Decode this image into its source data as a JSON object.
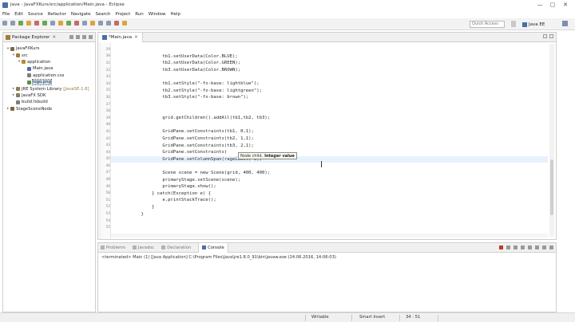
{
  "window": {
    "title": "Java - JavaFXKurs/src/application/Main.java - Eclipse",
    "controls": [
      "—",
      "▢",
      "✕"
    ]
  },
  "menu": [
    "File",
    "Edit",
    "Source",
    "Refactor",
    "Navigate",
    "Search",
    "Project",
    "Run",
    "Window",
    "Help"
  ],
  "toolbar": {
    "quick_access": "Quick Access",
    "perspective": "Java EE"
  },
  "explorer": {
    "tab": "Package Explorer",
    "tree": [
      {
        "label": "JavaFXKurs",
        "muted": "",
        "depth": 0,
        "twisty": "▾",
        "color": "#7a6a3a"
      },
      {
        "label": "src",
        "muted": "",
        "depth": 1,
        "twisty": "▾",
        "color": "#a07b3b"
      },
      {
        "label": "application",
        "muted": "",
        "depth": 2,
        "twisty": "▾",
        "color": "#b08a3e"
      },
      {
        "label": "Main.java",
        "muted": "",
        "depth": 3,
        "twisty": "",
        "color": "#4a6fa5"
      },
      {
        "label": "application.css",
        "muted": "",
        "depth": 3,
        "twisty": "",
        "color": "#7d7d7d"
      },
      {
        "label": "logo.png",
        "muted": "",
        "depth": 3,
        "twisty": "",
        "color": "#5b8f4a",
        "selected": true
      },
      {
        "label": "JRE System Library",
        "muted": "[JavaSE-1.8]",
        "depth": 1,
        "twisty": "▸",
        "color": "#8a7b5a"
      },
      {
        "label": "JavaFX SDK",
        "muted": "",
        "depth": 1,
        "twisty": "▸",
        "color": "#8a7b5a"
      },
      {
        "label": "build.fxbuild",
        "muted": "",
        "depth": 1,
        "twisty": "",
        "color": "#7d7d7d"
      },
      {
        "label": "StageSceneNode",
        "muted": "",
        "depth": 0,
        "twisty": "▸",
        "color": "#7a6a3a"
      }
    ]
  },
  "editor": {
    "tab": "*Main.java",
    "lines": [
      {
        "n": "29",
        "t": ""
      },
      {
        "n": "30",
        "t": "            tb1.setUserData(Color.BLUE);"
      },
      {
        "n": "31",
        "t": "            tb2.setUserData(Color.GREEN);"
      },
      {
        "n": "32",
        "t": "            tb3.setUserData(Color.BROWN);"
      },
      {
        "n": "33",
        "t": ""
      },
      {
        "n": "34",
        "t": "            tb1.setStyle(\"-fx-base: lightblue\");"
      },
      {
        "n": "35",
        "t": "            tb2.setStyle(\"-fx-base: lightgreen\");"
      },
      {
        "n": "36",
        "t": "            tb3.setStyle(\"-fx-base: brown\");"
      },
      {
        "n": "37",
        "t": ""
      },
      {
        "n": "38",
        "t": ""
      },
      {
        "n": "39",
        "t": "            grid.getChildren().addAll(tb1,tb2, tb3);"
      },
      {
        "n": "40",
        "t": ""
      },
      {
        "n": "41",
        "t": "            GridPane.setConstraints(tb1, 0,1);"
      },
      {
        "n": "42",
        "t": "            GridPane.setConstraints(tb2, 1,1);"
      },
      {
        "n": "43",
        "t": "            GridPane.setConstraints(tb3, 2,1);"
      },
      {
        "n": "44",
        "t": "            GridPane.setConstraints("
      },
      {
        "n": "45",
        "t": "            GridPane.setColumnSpan(rageLabel, 3);"
      },
      {
        "n": "46",
        "t": ""
      },
      {
        "n": "47",
        "t": "            Scene scene = new Scene(grid, 400, 400);"
      },
      {
        "n": "48",
        "t": "            primaryStage.setScene(scene);"
      },
      {
        "n": "49",
        "t": "            primaryStage.show();"
      },
      {
        "n": "50",
        "t": "        } catch(Exception e) {"
      },
      {
        "n": "51",
        "t": "            e.printStackTrace();"
      },
      {
        "n": "52",
        "t": "        }"
      },
      {
        "n": "53",
        "t": "    }"
      },
      {
        "n": "54",
        "t": ""
      },
      {
        "n": "55",
        "t": ""
      }
    ],
    "highlight_line": 16,
    "tooltip": {
      "param": "Node child,",
      "value": "Integer value"
    }
  },
  "bottom": {
    "tabs": [
      "Problems",
      "Javadoc",
      "Declaration",
      "Console"
    ],
    "active_tab": "Console",
    "console_header": "<terminated> Main (1) [Java Application] C:\\Program Files\\Java\\jre1.8.0_91\\bin\\javaw.exe (24.06.2016, 14:06:03)"
  },
  "status": {
    "writable": "Writable",
    "insert": "Smart Insert",
    "position": "34 : 51"
  }
}
